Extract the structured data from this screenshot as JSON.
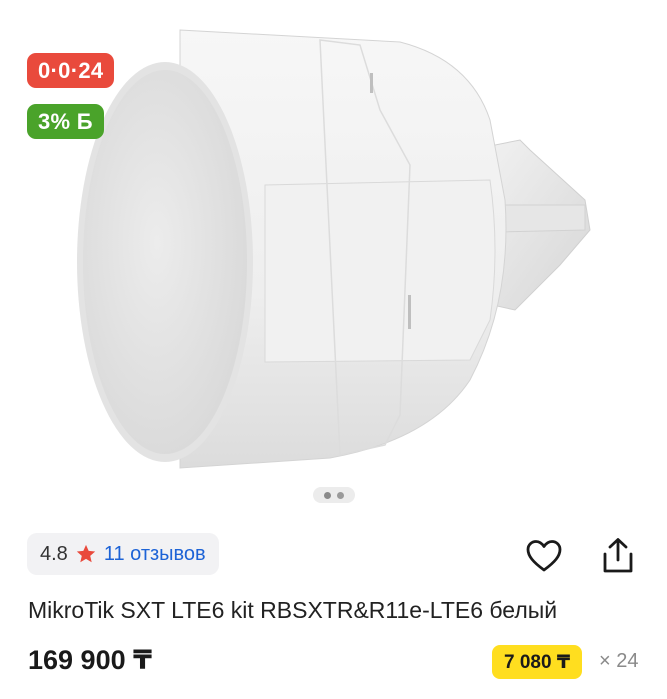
{
  "badges": {
    "installment_plan": "0·0·24",
    "bonus": "3% Б"
  },
  "gallery": {
    "image_icon": "mikrotik-sxt-lte6-device",
    "pagination_dots": 2,
    "active_dot": 1
  },
  "rating": {
    "value": "4.8",
    "star_color": "#e94a3c",
    "reviews": "11 отзывов"
  },
  "actions": {
    "favorite_icon": "heart-outline-icon",
    "share_icon": "share-icon"
  },
  "product": {
    "title": "MikroTik SXT LTE6 kit RBSXTR&R11e-LTE6 белый",
    "price": "169 900 ₸",
    "monthly_payment": "7 080 ₸",
    "months": "× 24"
  },
  "colors": {
    "installment_badge": "#e94a3c",
    "bonus_badge": "#4aa32a",
    "monthly_highlight": "#ffde1f",
    "link": "#1d63d6"
  }
}
